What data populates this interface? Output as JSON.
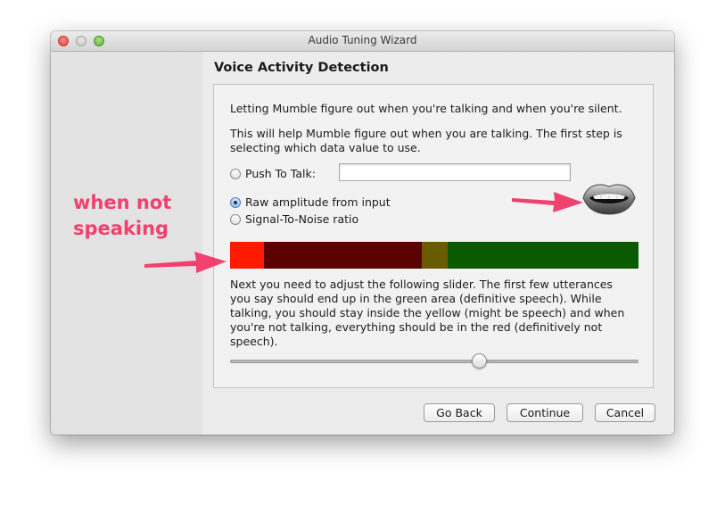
{
  "window": {
    "title": "Audio Tuning Wizard"
  },
  "page": {
    "heading": "Voice Activity Detection",
    "intro": "Letting Mumble figure out when you're talking and when you're silent.",
    "help_line1": "This will help Mumble figure out when you are talking. The first step is",
    "help_line2": "selecting which data value to use."
  },
  "options": {
    "push_to_talk_label": "Push To Talk:",
    "push_to_talk_value": "",
    "raw_amplitude_label": "Raw amplitude from input",
    "snr_label": "Signal-To-Noise ratio",
    "selected": "raw_amplitude"
  },
  "meter": {
    "segments": [
      {
        "name": "current-level",
        "color": "#ff1a00",
        "fraction": 0.083
      },
      {
        "name": "silence-zone",
        "color": "#5a0000",
        "fraction": 0.387
      },
      {
        "name": "maybe-speech-zone",
        "color": "#6a5a00",
        "fraction": 0.062
      },
      {
        "name": "speech-zone",
        "color": "#0a5a00",
        "fraction": 0.468
      }
    ]
  },
  "instructions": [
    "Next you need to adjust the following slider. The first few utterances",
    "you say should end up in the green area (definitive speech). While",
    "talking, you should stay inside the yellow (might be speech) and when",
    "you're not talking, everything should be in the red (definitively not",
    "speech)."
  ],
  "slider": {
    "value": 0.61
  },
  "buttons": {
    "back": "Go Back",
    "continue": "Continue",
    "cancel": "Cancel"
  },
  "annotation": {
    "line1": "when not",
    "line2": "speaking",
    "color": "#f0416f"
  }
}
